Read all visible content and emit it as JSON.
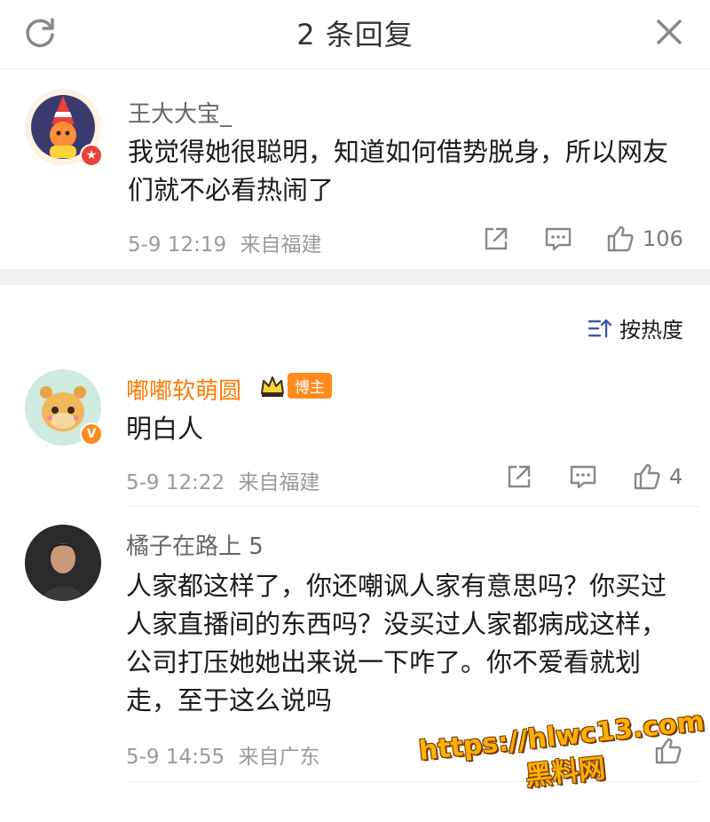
{
  "header": {
    "title": "2 条回复"
  },
  "parent_comment": {
    "user": "王大大宝_",
    "text": "我觉得她很聪明，知道如何借势脱身，所以网友们就不必看热闹了",
    "time": "5-9 12:19",
    "location": "来自福建",
    "likes": "106"
  },
  "sort": {
    "label": "按热度"
  },
  "replies": [
    {
      "user": "嘟嘟软萌圆",
      "badge": "博主",
      "text": "明白人",
      "time": "5-9 12:22",
      "location": "来自福建",
      "likes": "4"
    },
    {
      "user": "橘子在路上 5",
      "text": "人家都这样了，你还嘲讽人家有意思吗？你买过人家直播间的东西吗？没买过人家都病成这样，公司打压她她出来说一下咋了。你不爱看就划走，至于这么说吗",
      "time": "5-9 14:55",
      "location": "来自广东",
      "likes": ""
    }
  ],
  "watermark": {
    "url": "https://hlwc13.com",
    "name": "黑料网"
  },
  "colors": {
    "accent_orange": "#ff7a00",
    "verified_orange": "#ff8a1f",
    "divider": "#f2f2f2",
    "meta_gray": "#9a9a9a"
  },
  "icons": [
    "refresh-icon",
    "close-icon",
    "share-icon",
    "comment-icon",
    "like-icon",
    "sort-icon",
    "crown-icon"
  ]
}
